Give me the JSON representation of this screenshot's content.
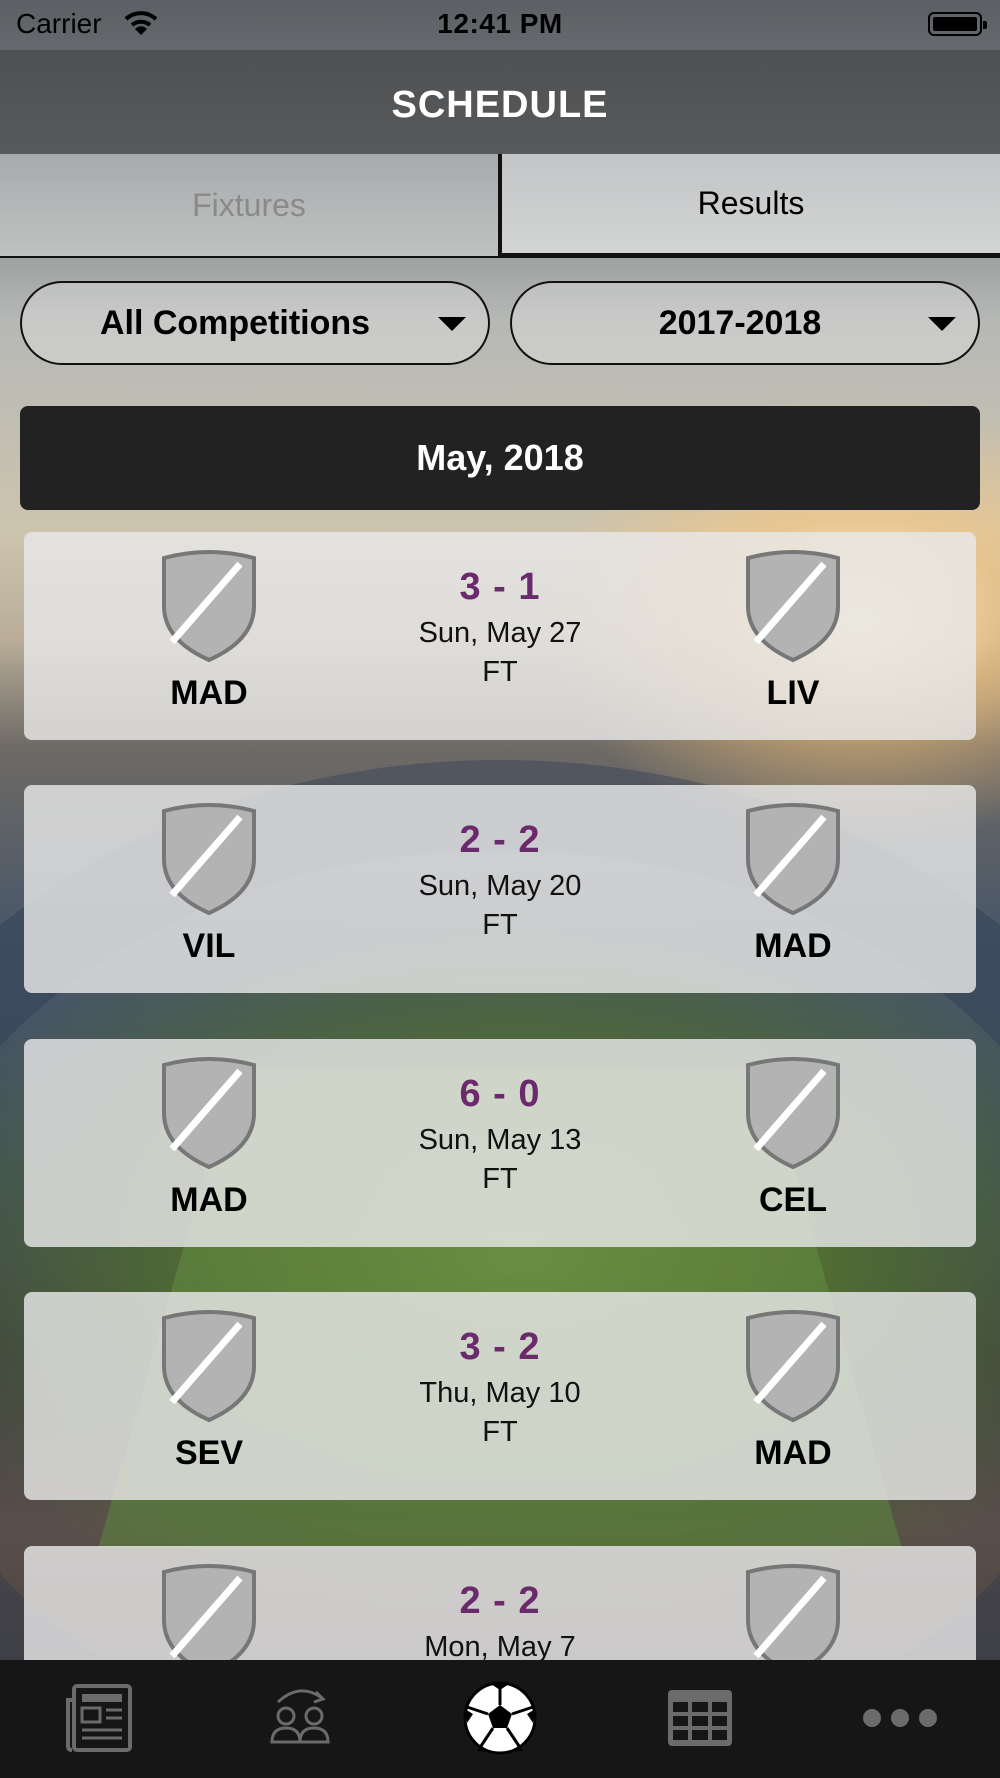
{
  "status_bar": {
    "carrier": "Carrier",
    "time": "12:41 PM"
  },
  "nav": {
    "title": "SCHEDULE"
  },
  "segments": [
    {
      "label": "Fixtures",
      "selected": false
    },
    {
      "label": "Results",
      "selected": true
    }
  ],
  "filters": {
    "competition": "All Competitions",
    "season": "2017-2018"
  },
  "month_header": "May, 2018",
  "matches": [
    {
      "home": "MAD",
      "away": "LIV",
      "score": "3 - 1",
      "date": "Sun, May 27",
      "status": "FT"
    },
    {
      "home": "VIL",
      "away": "MAD",
      "score": "2 - 2",
      "date": "Sun, May 20",
      "status": "FT"
    },
    {
      "home": "MAD",
      "away": "CEL",
      "score": "6 - 0",
      "date": "Sun, May 13",
      "status": "FT"
    },
    {
      "home": "SEV",
      "away": "MAD",
      "score": "3 - 2",
      "date": "Thu, May 10",
      "status": "FT"
    },
    {
      "home": "",
      "away": "",
      "score": "2 - 2",
      "date": "Mon, May 7",
      "status": ""
    }
  ],
  "tab_bar": [
    {
      "icon": "news-icon",
      "selected": false
    },
    {
      "icon": "transfers-icon",
      "selected": false
    },
    {
      "icon": "soccer-ball-icon",
      "selected": true
    },
    {
      "icon": "table-grid-icon",
      "selected": false
    },
    {
      "icon": "more-dots-icon",
      "selected": false
    }
  ],
  "colors": {
    "score": "#6a2a6b",
    "tab_bar": "#161616",
    "month_header": "#222222"
  }
}
